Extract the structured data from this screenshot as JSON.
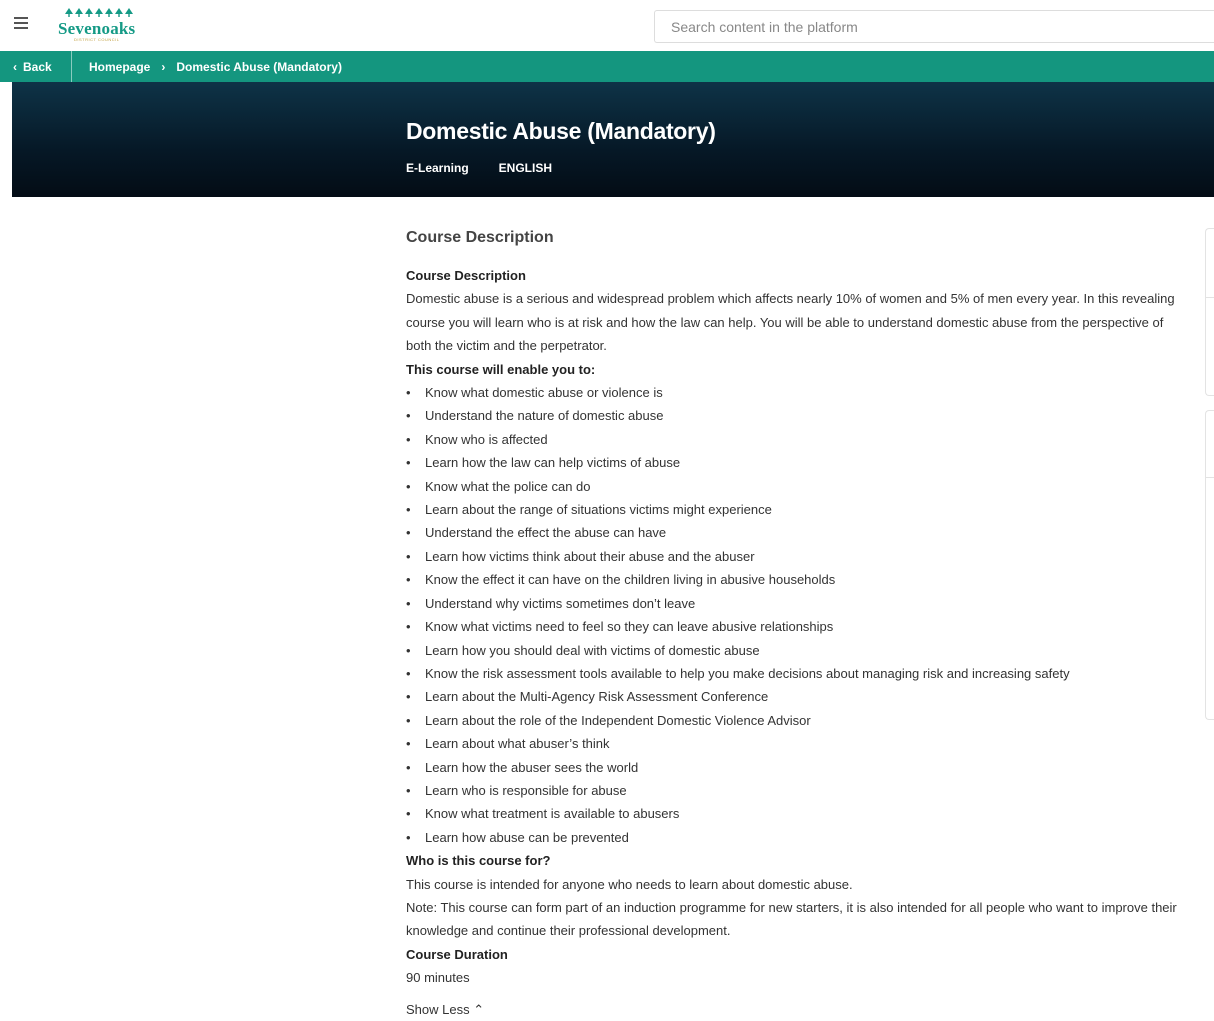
{
  "header": {
    "logo_text": "Sevenoaks",
    "logo_subtext": "DISTRICT COUNCIL",
    "search_placeholder": "Search content in the platform"
  },
  "breadcrumb": {
    "back_label": "Back",
    "items": [
      "Homepage",
      "Domestic Abuse (Mandatory)"
    ]
  },
  "hero": {
    "title": "Domestic Abuse (Mandatory)",
    "type": "E-Learning",
    "language": "ENGLISH"
  },
  "content": {
    "section_title": "Course Description",
    "desc_heading": "Course Description",
    "desc_text": "Domestic abuse is a serious and widespread problem which affects nearly 10% of women and 5% of men every year. In this revealing course you will learn who is at risk and how the law can help. You will be able to understand domestic abuse from the perspective of both the victim and the perpetrator.",
    "enable_heading": "This course will enable you to:",
    "objectives": [
      "Know what domestic abuse or violence is",
      "Understand the nature of domestic abuse",
      "Know who is affected",
      "Learn how the law can help victims of abuse",
      "Know what the police can do",
      "Learn about the range of situations victims might experience",
      "Understand the effect the abuse can have",
      "Learn how victims think about their abuse and the abuser",
      "Know the effect it can have on the children living in abusive households",
      "Understand why victims sometimes don’t leave",
      "Know what victims need to feel so they can leave abusive relationships",
      "Learn how you should deal with victims of domestic abuse",
      "Know the risk assessment tools available to help you make decisions about managing risk and increasing safety",
      "Learn about the Multi-Agency Risk Assessment Conference",
      "Learn about the role of the Independent Domestic Violence Advisor",
      "Learn about what abuser’s think",
      "Learn how the abuser sees the world",
      "Learn who is responsible for abuse",
      "Know what treatment is available to abusers",
      "Learn how abuse can be prevented"
    ],
    "audience_heading": "Who is this course for?",
    "audience_text": "This course is intended for anyone who needs to learn about domestic abuse.",
    "note_text": "Note: This course can form part of an induction programme for new starters, it is also intended for all people who want to improve their knowledge and continue their professional development.",
    "duration_heading": "Course Duration",
    "duration_value": "90 minutes",
    "show_less_label": "Show Less"
  },
  "colors": {
    "brand_teal": "#14967f",
    "hero_dark": "#061826",
    "logo_teal": "#159a86"
  }
}
